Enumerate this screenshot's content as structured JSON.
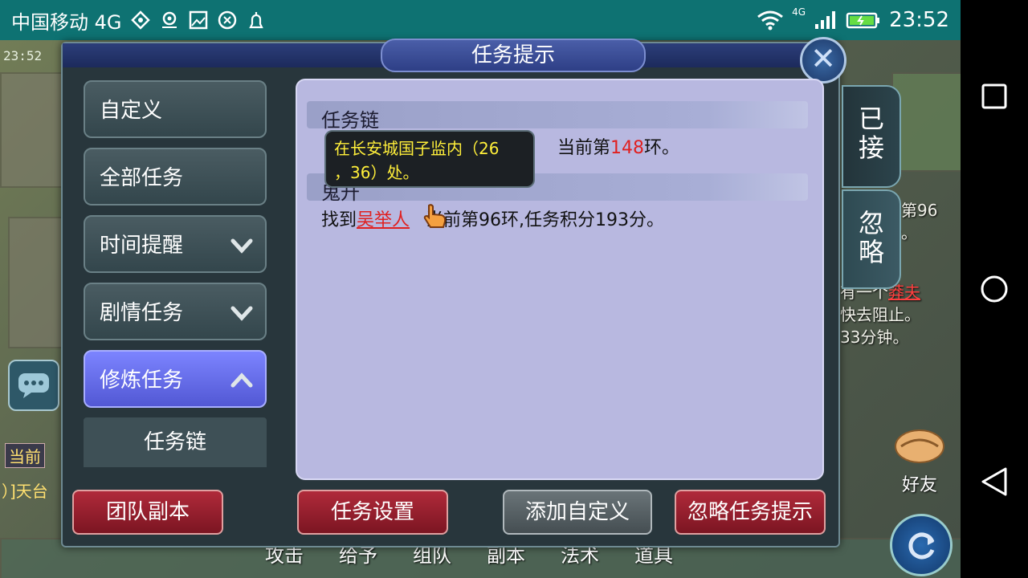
{
  "status_bar": {
    "carrier": "中国移动 4G",
    "network": "4G",
    "time": "23:52"
  },
  "game": {
    "small_clock": "23:52",
    "right_hud_lines": [
      "前第96",
      "分。",
      "有一个",
      "莽夫",
      "快去阻止。",
      "33分钟。"
    ],
    "friend_label": "好友",
    "chat_left_label": "当前",
    "chat_left_text": "）]天台",
    "bottom_hud": [
      "攻击",
      "给予",
      "组队",
      "副本",
      "法术",
      "道具"
    ]
  },
  "dialog": {
    "title": "任务提示",
    "close_symbol": "✕",
    "menu": [
      {
        "label": "自定义",
        "chevron": ""
      },
      {
        "label": "全部任务",
        "chevron": ""
      },
      {
        "label": "时间提醒",
        "chevron": "⌄"
      },
      {
        "label": "剧情任务",
        "chevron": "⌄"
      },
      {
        "label": "修炼任务",
        "chevron": "⌃"
      }
    ],
    "submenu_item": "任务链",
    "sections": [
      {
        "title": "任务链",
        "line_prefix": "当前第",
        "line_number": "148",
        "line_suffix": "环。"
      },
      {
        "title": "鬼升",
        "line_before": "找到",
        "link": "吴举人",
        "line_after": "当前第96环,任务积分193分。"
      }
    ],
    "tooltip_line1": "在长安城国子监内（26",
    "tooltip_line2": "，36）处。",
    "side_tabs": [
      "已接",
      "忽略"
    ],
    "buttons": {
      "team_dungeon": "团队副本",
      "task_settings": "任务设置",
      "add_custom": "添加自定义",
      "ignore_tips": "忽略任务提示"
    }
  },
  "colors": {
    "status_bar": "#0e7272",
    "menu_active": "#6a70f0",
    "content_panel": "#b8b8e0",
    "red_text": "#e02020",
    "tooltip_text": "#ffef3a",
    "button_red": "#9a1f2e"
  }
}
